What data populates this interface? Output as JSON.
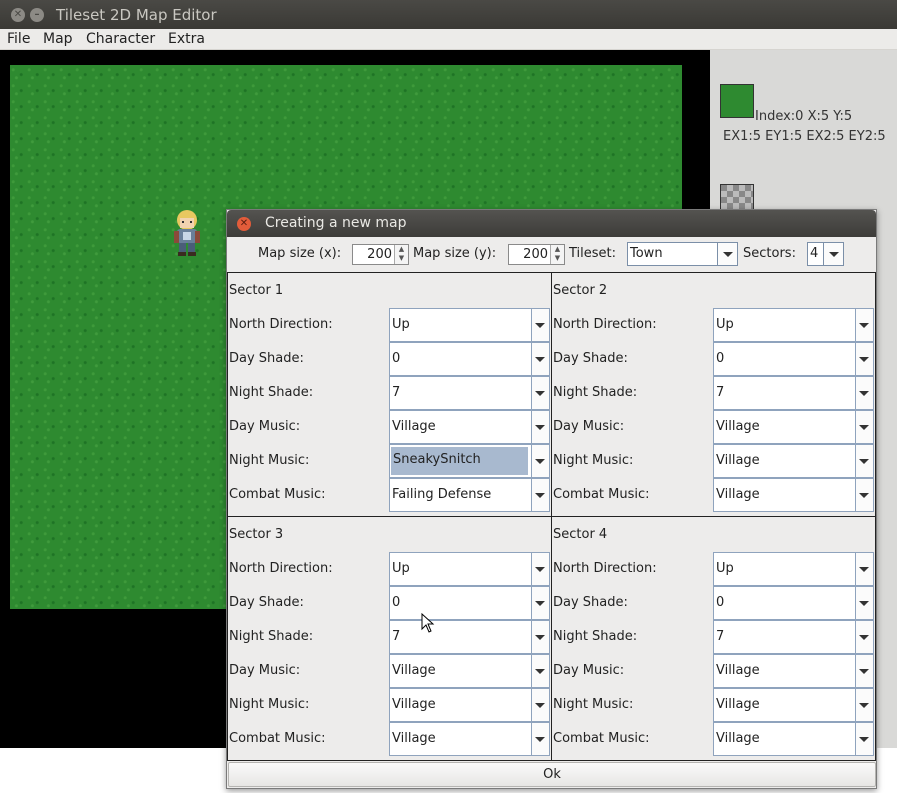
{
  "window": {
    "title": "Tileset 2D Map Editor"
  },
  "menu": {
    "items": [
      "File",
      "Map",
      "Character",
      "Extra"
    ]
  },
  "side_panel": {
    "tile_info_line1": "Index:0 X:5 Y:5",
    "tile_info_line2": "EX1:5 EY1:5 EX2:5 EY2:5"
  },
  "dialog": {
    "title": "Creating a new map",
    "map_size_x_label": "Map size (x):",
    "map_size_x": "200",
    "map_size_y_label": "Map size (y):",
    "map_size_y": "200",
    "tileset_label": "Tileset:",
    "tileset": "Town",
    "sectors_label": "Sectors:",
    "sectors": "4",
    "field_labels": {
      "north_direction": "North Direction:",
      "day_shade": "Day Shade:",
      "night_shade": "Night Shade:",
      "day_music": "Day Music:",
      "night_music": "Night Music:",
      "combat_music": "Combat Music:"
    },
    "sectors_list": [
      {
        "title": "Sector 1",
        "north_direction": "Up",
        "day_shade": "0",
        "night_shade": "7",
        "day_music": "Village",
        "night_music": "SneakySnitch",
        "combat_music": "Failing Defense"
      },
      {
        "title": "Sector 2",
        "north_direction": "Up",
        "day_shade": "0",
        "night_shade": "7",
        "day_music": "Village",
        "night_music": "Village",
        "combat_music": "Village"
      },
      {
        "title": "Sector 3",
        "north_direction": "Up",
        "day_shade": "0",
        "night_shade": "7",
        "day_music": "Village",
        "night_music": "Village",
        "combat_music": "Village"
      },
      {
        "title": "Sector 4",
        "north_direction": "Up",
        "day_shade": "0",
        "night_shade": "7",
        "day_music": "Village",
        "night_music": "Village",
        "combat_music": "Village"
      }
    ],
    "ok_label": "Ok"
  },
  "colors": {
    "grass": "#2e8a30",
    "selection": "#a8b9cf",
    "close_button": "#e25c3a"
  }
}
